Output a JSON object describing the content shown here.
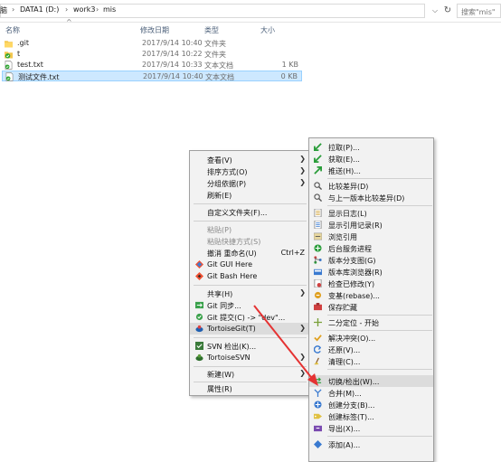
{
  "address": {
    "crumbs": [
      "脑",
      "DATA1 (D:)",
      "work3",
      "mis"
    ],
    "refresh_icon": "refresh-icon",
    "search_placeholder": "搜索\"mis\""
  },
  "columns": {
    "name": "名称",
    "date": "修改日期",
    "type": "类型",
    "size": "大小"
  },
  "files": [
    {
      "name": ".git",
      "date": "2017/9/14 10:40",
      "type": "文件夹",
      "size": "",
      "icon": "folder-icon"
    },
    {
      "name": "t",
      "date": "2017/9/14 10:22",
      "type": "文件夹",
      "size": "",
      "icon": "git-folder-icon"
    },
    {
      "name": "test.txt",
      "date": "2017/9/14 10:33",
      "type": "文本文档",
      "size": "1 KB",
      "icon": "text-file-icon"
    },
    {
      "name": "测试文件.txt",
      "date": "2017/9/14 10:40",
      "type": "文本文档",
      "size": "0 KB",
      "icon": "text-file-icon"
    }
  ],
  "context_menu": {
    "view": "查看(V)",
    "sort": "排序方式(O)",
    "group": "分组依据(P)",
    "refresh": "刷新(E)",
    "customize": "自定义文件夹(F)...",
    "paste": "粘贴(P)",
    "paste_shortcut": "粘贴快捷方式(S)",
    "undo": "撤消 重命名(U)",
    "undo_shortcut": "Ctrl+Z",
    "git_gui": "Git GUI Here",
    "git_bash": "Git Bash Here",
    "share": "共享(H)",
    "git_sync": "Git 同步...",
    "git_commit": "Git 提交(C) -> \"dev\"...",
    "tortoisegit": "TortoiseGit(T)",
    "svn_checkout": "SVN 检出(K)...",
    "tortoisesvn": "TortoiseSVN",
    "new": "新建(W)",
    "properties": "属性(R)"
  },
  "submenu": {
    "items": [
      {
        "label": "拉取(P)...",
        "icon": "pull-icon"
      },
      {
        "label": "获取(E)...",
        "icon": "fetch-icon"
      },
      {
        "label": "推送(H)...",
        "icon": "push-icon"
      },
      {
        "label": "比较差异(D)",
        "icon": "diff-icon"
      },
      {
        "label": "与上一版本比较差异(D)",
        "icon": "diff-previous-icon"
      },
      {
        "label": "显示日志(L)",
        "icon": "log-icon"
      },
      {
        "label": "显示引用记录(R)",
        "icon": "reflog-icon"
      },
      {
        "label": "浏览引用",
        "icon": "browse-references-icon"
      },
      {
        "label": "后台服务进程",
        "icon": "daemon-icon"
      },
      {
        "label": "版本分支图(G)",
        "icon": "revision-graph-icon"
      },
      {
        "label": "版本库浏览器(R)",
        "icon": "repo-browser-icon"
      },
      {
        "label": "检查已修改(Y)",
        "icon": "check-modifications-icon"
      },
      {
        "label": "变基(rebase)...",
        "icon": "rebase-icon"
      },
      {
        "label": "保存贮藏",
        "icon": "stash-icon"
      },
      {
        "label": "二分定位 - 开始",
        "icon": "bisect-icon"
      },
      {
        "label": "解决冲突(O)...",
        "icon": "resolve-icon"
      },
      {
        "label": "还原(V)...",
        "icon": "revert-icon"
      },
      {
        "label": "清理(C)...",
        "icon": "cleanup-icon"
      },
      {
        "label": "切换/检出(W)...",
        "icon": "switch-checkout-icon"
      },
      {
        "label": "合并(M)...",
        "icon": "merge-icon"
      },
      {
        "label": "创建分支(B)...",
        "icon": "create-branch-icon"
      },
      {
        "label": "创建标签(T)...",
        "icon": "create-tag-icon"
      },
      {
        "label": "导出(X)...",
        "icon": "export-icon"
      },
      {
        "label": "添加(A)...",
        "icon": "add-icon"
      }
    ]
  },
  "colors": {
    "selection": "#cde8ff",
    "menu_bg": "#f2f2f2",
    "annotation_arrow": "#e53333"
  }
}
